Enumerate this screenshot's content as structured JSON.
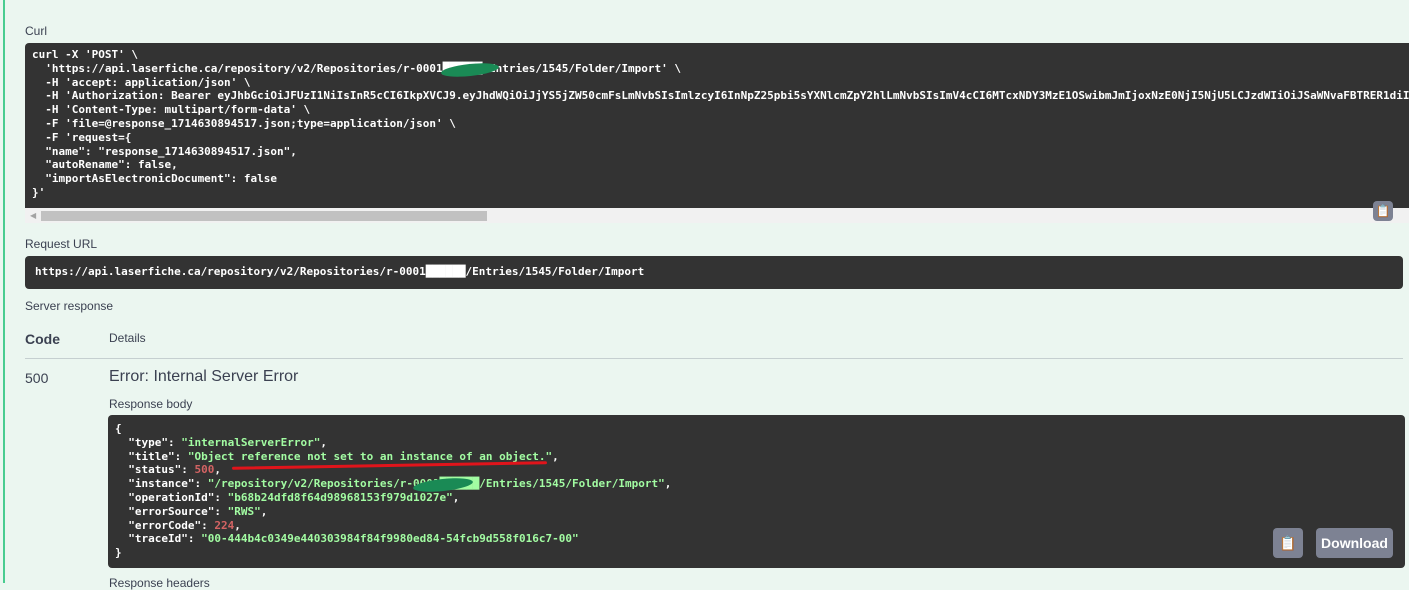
{
  "curl": {
    "label": "Curl",
    "lines": [
      "curl -X 'POST' \\",
      "  'https://api.laserfiche.ca/repository/v2/Repositories/r-0001██████/Entries/1545/Folder/Import' \\",
      "  -H 'accept: application/json' \\",
      "  -H 'Authorization: Bearer eyJhbGciOiJFUzI1NiIsInR5cCI6IkpXVCJ9.eyJhdWQiOiJjYS5jZW50cmFsLmNvbSIsImlzcyI6InNpZ25pbi5sYXNlcmZpY2hlLmNvbSIsImV4cCI6MTcxNDY3MzE1OSwibmJmIjoxNzE0NjI5NjU5LCJzdWIiOiJSaWNvaFBTRER1diI",
      "  -H 'Content-Type: multipart/form-data' \\",
      "  -F 'file=@response_1714630894517.json;type=application/json' \\",
      "  -F 'request={",
      "  \"name\": \"response_1714630894517.json\",",
      "  \"autoRename\": false,",
      "  \"importAsElectronicDocument\": false",
      "}'"
    ]
  },
  "request_url": {
    "label": "Request URL",
    "value": "https://api.laserfiche.ca/repository/v2/Repositories/r-0001██████/Entries/1545/Folder/Import"
  },
  "server_response": {
    "label": "Server response",
    "col_code": "Code",
    "col_details": "Details",
    "code": "500",
    "error": "Error: Internal Server Error",
    "body_label": "Response body",
    "headers_label": "Response headers",
    "body": {
      "type": "\"internalServerError\"",
      "title": "\"Object reference not set to an instance of an object.\"",
      "status": "500",
      "instance": "\"/repository/v2/Repositories/r-0001██████/Entries/1545/Folder/Import\"",
      "operationId": "\"b68b24dfd8f64d98968153f979d1027e\"",
      "errorSource": "\"RWS\"",
      "errorCode": "224",
      "traceId": "\"00-444b4c0349e440303984f84f9980ed84-54fcb9d558f016c7-00\""
    },
    "download_label": "Download"
  }
}
